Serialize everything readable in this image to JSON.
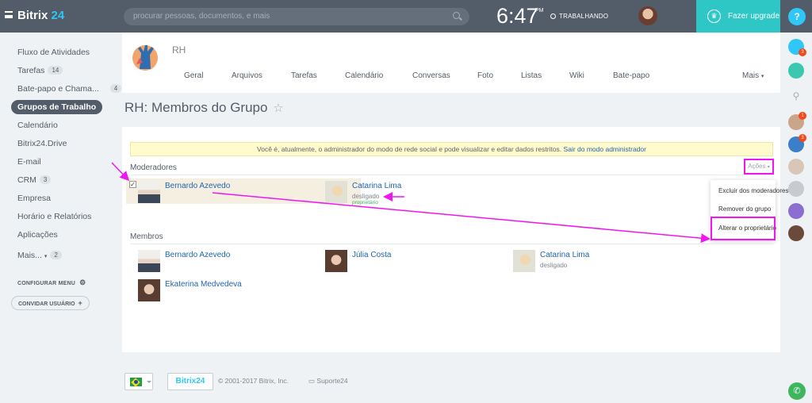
{
  "header": {
    "logo_text": "Bitrix",
    "logo_suffix": "24",
    "search_placeholder": "procurar pessoas, documentos, e mais",
    "time": "6:47",
    "ampm": "PM",
    "status": "TRABALHANDO",
    "upgrade_label": "Fazer upgrade",
    "help_label": "?"
  },
  "sidebar": {
    "items": [
      {
        "label": "Fluxo de Atividades"
      },
      {
        "label": "Tarefas",
        "badge": "14"
      },
      {
        "label": "Bate-papo e Chama...",
        "badge": "4"
      },
      {
        "label": "Grupos de Trabalho"
      },
      {
        "label": "Calendário"
      },
      {
        "label": "Bitrix24.Drive"
      },
      {
        "label": "E-mail"
      },
      {
        "label": "CRM",
        "badge": "3"
      },
      {
        "label": "Empresa"
      },
      {
        "label": "Horário e Relatórios"
      },
      {
        "label": "Aplicações"
      },
      {
        "label": "Mais...",
        "badge": "2"
      }
    ],
    "configure_menu": "CONFIGURAR MENU",
    "invite_user": "CONVIDAR USUÁRIO"
  },
  "right_bar": {
    "notifications_count": "3",
    "avatar_count_1": "1",
    "avatar_count_2": "3"
  },
  "group": {
    "name": "RH",
    "tabs": [
      "Geral",
      "Arquivos",
      "Tarefas",
      "Calendário",
      "Conversas",
      "Foto",
      "Listas",
      "Wiki",
      "Bate-papo",
      "Mais"
    ]
  },
  "page": {
    "title": "RH: Membros do Grupo",
    "star": "☆"
  },
  "notice": {
    "text": "Você é, atualmente, o administrador do modo de rede social e pode visualizar e editar dados restritos.",
    "link": "Sair do modo administrador"
  },
  "moderators": {
    "title": "Moderadores",
    "actions_label": "Ações",
    "people": [
      {
        "name": "Bernardo Azevedo",
        "status": "",
        "role": ""
      },
      {
        "name": "Catarina Lima",
        "status": "desligado",
        "role": "proprietário"
      }
    ]
  },
  "actions_menu": {
    "items": [
      "Excluir dos moderadores",
      "Remover do grupo",
      "Alterar o proprietário"
    ]
  },
  "members": {
    "title": "Membros",
    "people": [
      {
        "name": "Bernardo Azevedo",
        "status": ""
      },
      {
        "name": "Júlia Costa",
        "status": ""
      },
      {
        "name": "Catarina Lima",
        "status": "desligado"
      },
      {
        "name": "Ekaterina Medvedeva",
        "status": ""
      }
    ]
  },
  "footer": {
    "logo": "Bitrix24",
    "copyright": "© 2001-2017 Bitrix, Inc.",
    "support": "Suporte24"
  },
  "colors": {
    "topbar": "#535c69",
    "accent": "#2fc7f7",
    "upgrade": "#2fc6c6",
    "annotation": "#f016f0",
    "link": "#2067b0"
  }
}
